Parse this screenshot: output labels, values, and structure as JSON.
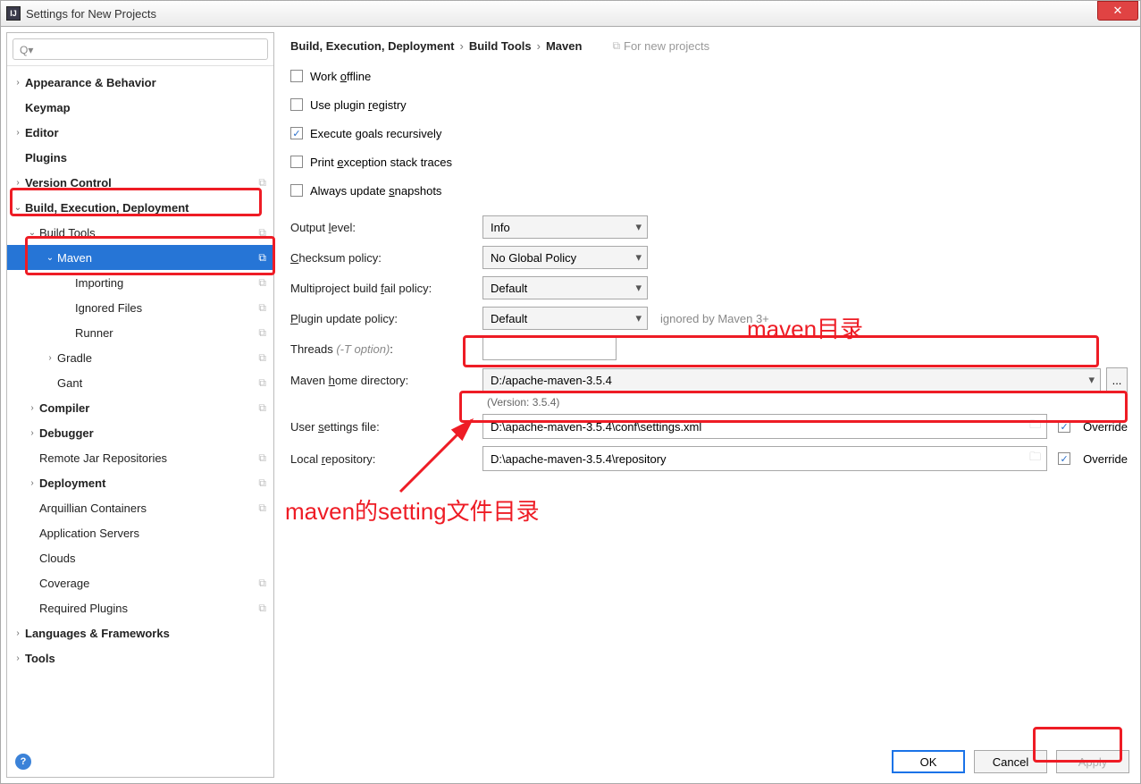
{
  "window": {
    "title": "Settings for New Projects"
  },
  "sidebar": {
    "search_placeholder": "",
    "items": [
      {
        "label": "Appearance & Behavior",
        "bold": true,
        "chev": "›",
        "indent": 0
      },
      {
        "label": "Keymap",
        "bold": true,
        "chev": "",
        "indent": 0
      },
      {
        "label": "Editor",
        "bold": true,
        "chev": "›",
        "indent": 0
      },
      {
        "label": "Plugins",
        "bold": true,
        "chev": "",
        "indent": 0
      },
      {
        "label": "Version Control",
        "bold": true,
        "chev": "›",
        "indent": 0,
        "copy": true
      },
      {
        "label": "Build, Execution, Deployment",
        "bold": true,
        "chev": "⌄",
        "indent": 0
      },
      {
        "label": "Build Tools",
        "bold": false,
        "chev": "⌄",
        "indent": 1,
        "copy": true
      },
      {
        "label": "Maven",
        "bold": false,
        "chev": "⌄",
        "indent": 2,
        "copy": true,
        "selected": true
      },
      {
        "label": "Importing",
        "bold": false,
        "chev": "",
        "indent": 3,
        "copy": true
      },
      {
        "label": "Ignored Files",
        "bold": false,
        "chev": "",
        "indent": 3,
        "copy": true
      },
      {
        "label": "Runner",
        "bold": false,
        "chev": "",
        "indent": 3,
        "copy": true
      },
      {
        "label": "Gradle",
        "bold": false,
        "chev": "›",
        "indent": 2,
        "copy": true
      },
      {
        "label": "Gant",
        "bold": false,
        "chev": "",
        "indent": 2,
        "copy": true
      },
      {
        "label": "Compiler",
        "bold": true,
        "chev": "›",
        "indent": 1,
        "copy": true
      },
      {
        "label": "Debugger",
        "bold": true,
        "chev": "›",
        "indent": 1
      },
      {
        "label": "Remote Jar Repositories",
        "bold": false,
        "chev": "",
        "indent": 1,
        "copy": true
      },
      {
        "label": "Deployment",
        "bold": true,
        "chev": "›",
        "indent": 1,
        "copy": true
      },
      {
        "label": "Arquillian Containers",
        "bold": false,
        "chev": "",
        "indent": 1,
        "copy": true
      },
      {
        "label": "Application Servers",
        "bold": false,
        "chev": "",
        "indent": 1
      },
      {
        "label": "Clouds",
        "bold": false,
        "chev": "",
        "indent": 1
      },
      {
        "label": "Coverage",
        "bold": false,
        "chev": "",
        "indent": 1,
        "copy": true
      },
      {
        "label": "Required Plugins",
        "bold": false,
        "chev": "",
        "indent": 1,
        "copy": true
      },
      {
        "label": "Languages & Frameworks",
        "bold": true,
        "chev": "›",
        "indent": 0
      },
      {
        "label": "Tools",
        "bold": true,
        "chev": "›",
        "indent": 0
      }
    ]
  },
  "breadcrumb": {
    "part1": "Build, Execution, Deployment",
    "part2": "Build Tools",
    "part3": "Maven",
    "hint": "For new projects"
  },
  "checks": {
    "work_offline": {
      "label": "Work offline",
      "checked": false
    },
    "use_plugin_registry": {
      "label": "Use plugin registry",
      "checked": false
    },
    "execute_goals": {
      "label": "Execute goals recursively",
      "checked": true
    },
    "print_exception": {
      "label": "Print exception stack traces",
      "checked": false
    },
    "always_update": {
      "label": "Always update snapshots",
      "checked": false
    }
  },
  "fields": {
    "output_level": {
      "label": "Output level:",
      "value": "Info"
    },
    "checksum_policy": {
      "label": "Checksum policy:",
      "value": "No Global Policy"
    },
    "multiproject_fail": {
      "label": "Multiproject build fail policy:",
      "value": "Default"
    },
    "plugin_update": {
      "label": "Plugin update policy:",
      "value": "Default",
      "note": "ignored by Maven 3+"
    },
    "threads": {
      "label": "Threads (-T option):",
      "value": ""
    },
    "maven_home": {
      "label": "Maven home directory:",
      "value": "D:/apache-maven-3.5.4",
      "version": "(Version: 3.5.4)"
    },
    "user_settings": {
      "label": "User settings file:",
      "value": "D:\\apache-maven-3.5.4\\conf\\settings.xml",
      "override_label": "Override",
      "override": true
    },
    "local_repo": {
      "label": "Local repository:",
      "value": "D:\\apache-maven-3.5.4\\repository",
      "override_label": "Override",
      "override": true
    }
  },
  "buttons": {
    "ok": "OK",
    "cancel": "Cancel",
    "apply": "Apply",
    "browse": "..."
  },
  "annotations": {
    "text1": "maven目录",
    "text2": "maven的setting文件目录"
  }
}
